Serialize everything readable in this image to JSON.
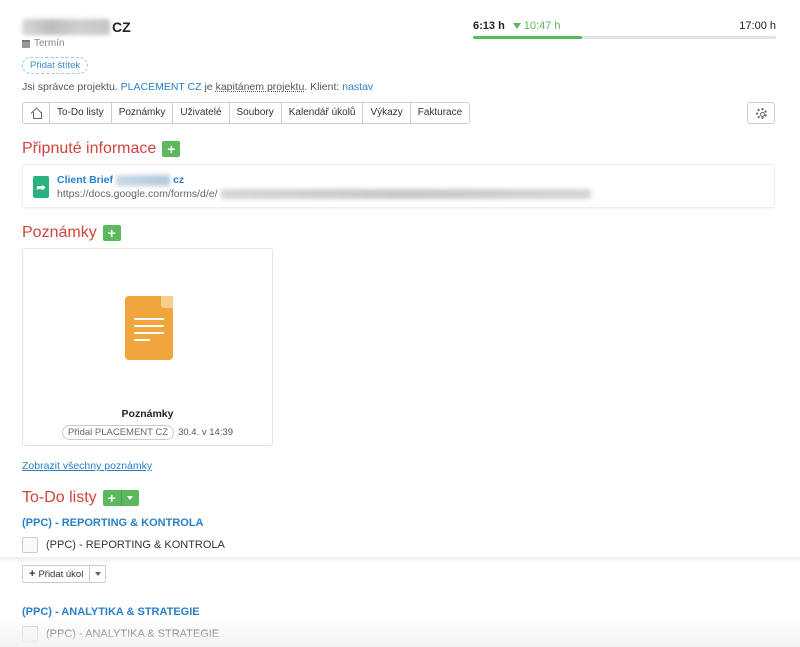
{
  "header": {
    "title_suffix": "CZ",
    "deadline_label": "Termín"
  },
  "time": {
    "spent": "6:13 h",
    "estimate": "10:47 h",
    "total": "17:00 h",
    "progress_fraction": 0.36
  },
  "tag_button": "Přidat štítek",
  "info": {
    "prefix": "Jsi správce projektu.",
    "company": "PLACEMENT CZ",
    "je": "je",
    "captain": "kapitánem projektu",
    "client_label": ". Klient:",
    "client_link": "nastav"
  },
  "tabs": [
    "To-Do listy",
    "Poznámky",
    "Uživatelé",
    "Soubory",
    "Kalendář úkolů",
    "Výkazy",
    "Fakturace"
  ],
  "sections": {
    "pinned": "Připnuté informace",
    "notes": "Poznámky",
    "todos": "To-Do listy"
  },
  "pinned_item": {
    "title_prefix": "Client Brief",
    "title_suffix": "cz",
    "url_prefix": "https://docs.google.com/forms/d/e/"
  },
  "note_card": {
    "title": "Poznámky",
    "added_by": "Přidal PLACEMENT CZ",
    "date": "30.4. v 14:39"
  },
  "show_all_notes": "Zobrazit všechny poznámky",
  "todo_lists": [
    {
      "title": "(PPC) - REPORTING & KONTROLA",
      "item": "(PPC) - REPORTING & KONTROLA"
    },
    {
      "title": "(PPC) - ANALYTIKA & STRATEGIE",
      "item": "(PPC) - ANALYTIKA & STRATEGIE"
    }
  ],
  "add_task": "Přidat úkol",
  "colors": {
    "section_red": "#d0443c",
    "link_blue": "#2a7fc9",
    "green": "#5cb85c"
  }
}
